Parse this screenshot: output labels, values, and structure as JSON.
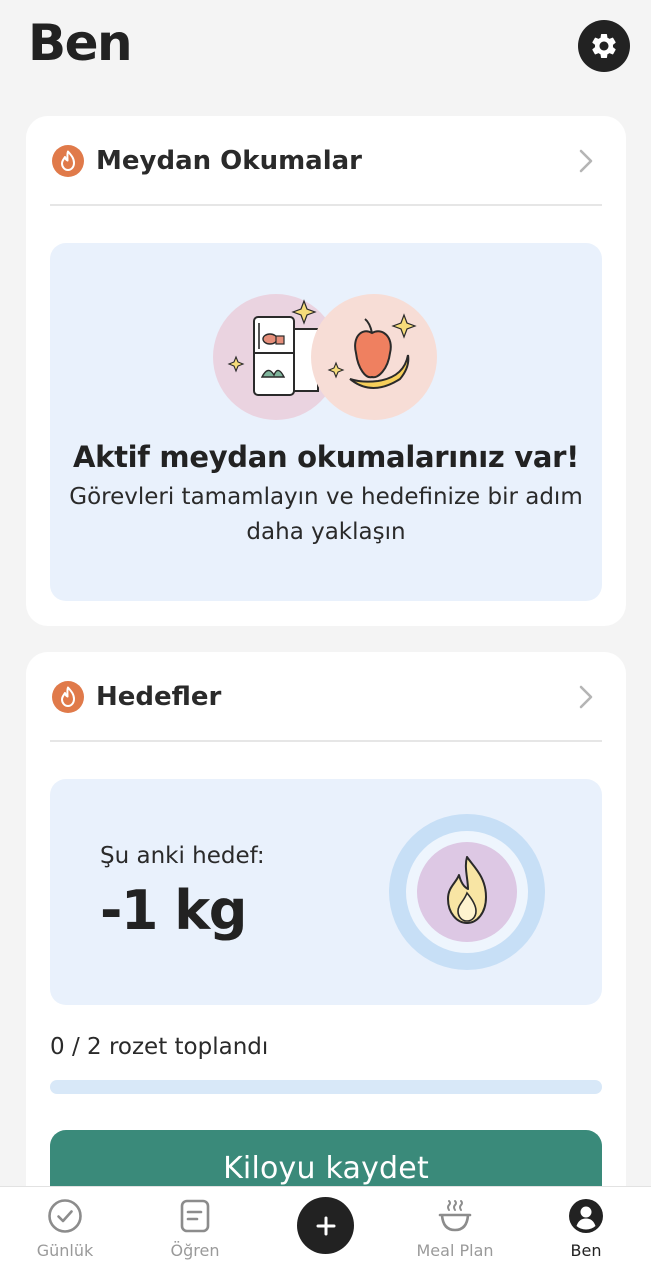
{
  "header": {
    "title": "Ben"
  },
  "challenges_card": {
    "title": "Meydan Okumalar",
    "heading": "Aktif meydan okumalarınız var!",
    "subtitle": "Görevleri tamamlayın ve hedefinize bir adım daha yaklaşın"
  },
  "goals_card": {
    "title": "Hedefler",
    "current_goal_label": "Şu anki hedef:",
    "current_goal_value": "-1 kg",
    "badges_text": "0 / 2 rozet toplandı",
    "badges_collected": 0,
    "badges_total": 2,
    "button_label": "Kiloyu kaydet"
  },
  "tabbar": {
    "items": [
      {
        "label": "Günlük",
        "icon": "check-circle-icon"
      },
      {
        "label": "Öğren",
        "icon": "document-icon"
      },
      {
        "label": "",
        "icon": "plus-icon"
      },
      {
        "label": "Meal Plan",
        "icon": "bowl-icon"
      },
      {
        "label": "Ben",
        "icon": "profile-icon"
      }
    ]
  },
  "colors": {
    "accent": "#3a8a7a",
    "flame": "#e07a4a",
    "panel": "#e9f1fc"
  }
}
